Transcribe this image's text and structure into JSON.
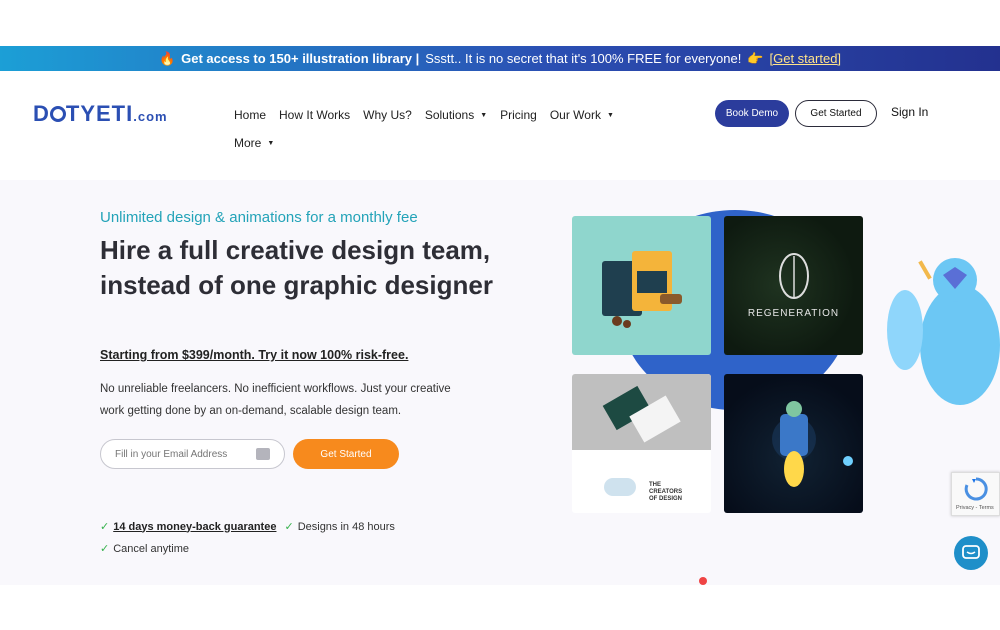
{
  "promo": {
    "fire": "🔥",
    "bold": "Get access to 150+ illustration library |",
    "text": "Ssstt.. It is no secret that it's 100% FREE for everyone!",
    "hand": "👉",
    "link": "[Get started]"
  },
  "logo": {
    "main_a": "D",
    "main_b": "TYETI",
    "com": ".com"
  },
  "nav": {
    "items": [
      {
        "label": "Home"
      },
      {
        "label": "How It Works"
      },
      {
        "label": "Why Us?"
      },
      {
        "label": "Solutions"
      },
      {
        "label": "Pricing"
      },
      {
        "label": "Our Work"
      },
      {
        "label": "More"
      }
    ],
    "caret": "▼"
  },
  "header_actions": {
    "book_demo": "Book Demo",
    "get_started": "Get Started",
    "sign_in": "Sign In"
  },
  "hero": {
    "tagline": "Unlimited design & animations for a monthly fee",
    "headline": "Hire a full creative design team, instead of one graphic designer",
    "price_line": "Starting from $399/month. Try it now 100% risk-free.",
    "description": "No unreliable freelancers. No inefficient workflows. Just your creative work getting done by an on-demand, scalable design team.",
    "email_placeholder": "Fill in your Email Address",
    "cta": "Get Started"
  },
  "bullets": [
    {
      "text": "14 days money-back guarantee"
    },
    {
      "text": "Designs in 48 hours"
    },
    {
      "text": "Cancel anytime"
    }
  ],
  "check_glyph": "✓",
  "portfolio": {
    "regeneration": "REGENERATION",
    "creators": "THE CREATORS OF DESIGN"
  },
  "recaptcha": {
    "text": "Privacy - Terms"
  },
  "colors": {
    "brand_blue": "#2b3c9c",
    "accent_orange": "#f78a1d",
    "tagline_teal": "#23a3b8"
  }
}
